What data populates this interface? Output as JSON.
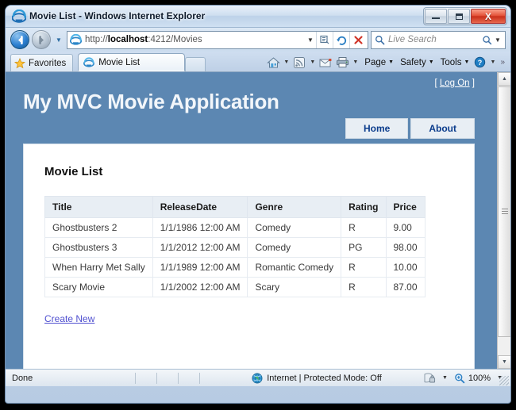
{
  "window": {
    "title": "Movie List - Windows Internet Explorer",
    "minimize_label": "Minimize",
    "maximize_label": "Maximize",
    "close_label": "X"
  },
  "nav": {
    "back_glyph": "←",
    "forward_glyph": "→",
    "history_glyph": "▼"
  },
  "address": {
    "url_scheme": "http://",
    "url_host": "localhost",
    "url_path": ":4212/Movies",
    "url_full": "http://localhost:4212/Movies",
    "dropdown_glyph": "▼",
    "compat_icon": "compatibility-view-icon",
    "refresh_glyph": "↻",
    "stop_glyph": "✕"
  },
  "search": {
    "placeholder": "Live Search",
    "dropdown_glyph": "▼"
  },
  "toolbar": {
    "favorites_label": "Favorites",
    "tab_label": "Movie List",
    "new_tab_label": "",
    "home_icon": "home-icon",
    "feeds_icon": "rss-feed-icon",
    "mail_icon": "mail-icon",
    "print_icon": "printer-icon",
    "menus": [
      {
        "label": "Page"
      },
      {
        "label": "Safety"
      },
      {
        "label": "Tools"
      }
    ],
    "help_icon": "help-icon",
    "overflow_glyph": "»",
    "dropdown_glyph": "▼"
  },
  "site": {
    "title": "My MVC Movie Application",
    "logon_open": "[",
    "logon_label": "Log On",
    "logon_close": "]",
    "nav_tabs": [
      {
        "label": "Home"
      },
      {
        "label": "About"
      }
    ]
  },
  "content": {
    "heading": "Movie List",
    "create_new_label": "Create New",
    "table": {
      "columns": [
        "Title",
        "ReleaseDate",
        "Genre",
        "Rating",
        "Price"
      ],
      "rows": [
        [
          "Ghostbusters 2",
          "1/1/1986 12:00 AM",
          "Comedy",
          "R",
          "9.00"
        ],
        [
          "Ghostbusters 3",
          "1/1/2012 12:00 AM",
          "Comedy",
          "PG",
          "98.00"
        ],
        [
          "When Harry Met Sally",
          "1/1/1989 12:00 AM",
          "Romantic Comedy",
          "R",
          "10.00"
        ],
        [
          "Scary Movie",
          "1/1/2002 12:00 AM",
          "Scary",
          "R",
          "87.00"
        ]
      ]
    }
  },
  "scrollbar": {
    "up_glyph": "▲",
    "down_glyph": "▼"
  },
  "status": {
    "message": "Done",
    "zone": "Internet | Protected Mode: Off",
    "zone_icon": "globe-icon",
    "privacy_icon": "privacy-lock-icon",
    "zoom_icon": "zoom-icon",
    "zoom_level": "100%",
    "caret_glyph": "▼"
  },
  "colors": {
    "header_blue": "#5c87b2",
    "panel_light": "#e8eef4",
    "link_blue": "#5050d0",
    "nav_text": "#0b3c8c"
  }
}
